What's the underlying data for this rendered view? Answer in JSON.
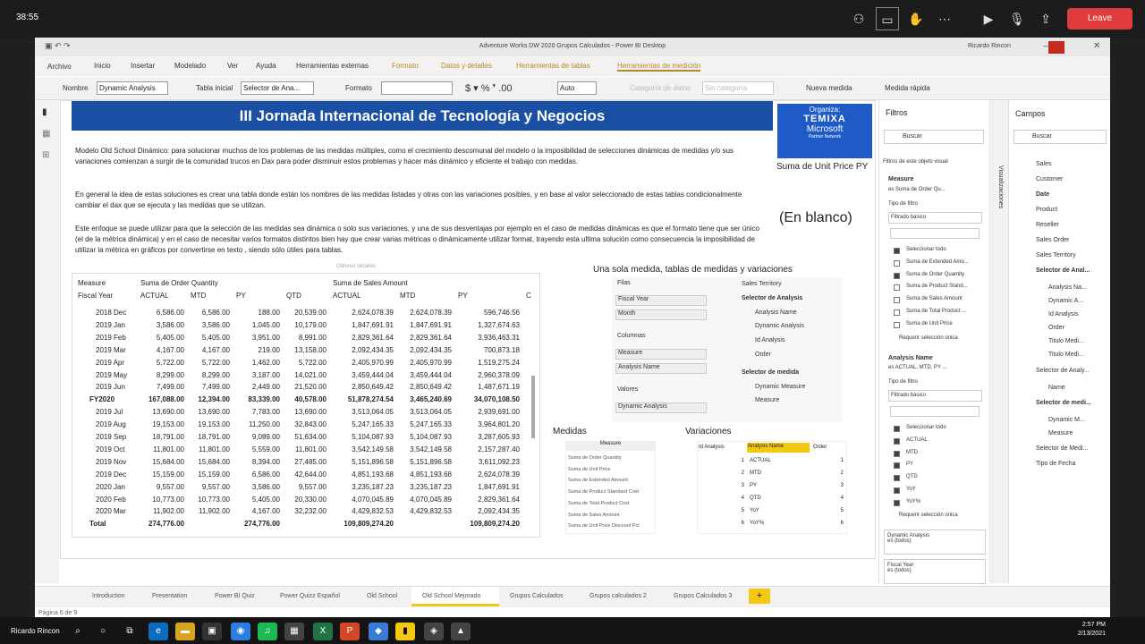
{
  "zoom": {
    "clock": "38:55",
    "leave": "Leave",
    "name": "Ricardo Rincon",
    "time": "2:57 PM",
    "date": "2/13/2021"
  },
  "window": {
    "title": "Adventure Works DW 2020 Grupos Calculados - Power BI Desktop",
    "user": "Ricardo Rincon"
  },
  "menu": [
    "Archivo",
    "Inicio",
    "Insertar",
    "Modelado",
    "Ver",
    "Ayuda",
    "Herramientas externas",
    "Formato",
    "Datos y detalles",
    "Herramientas de tablas",
    "Herramientas de medición"
  ],
  "toolbar": {
    "nombre_label": "Nombre",
    "nombre_value": "Dynamic Analysis",
    "tabla_label": "Tabla inicial",
    "tabla_value": "Selector de Ana...",
    "formato_label": "Formato",
    "auto_value": "Auto",
    "categoria": "Categoría de datos",
    "sin_categoria": "Sin categoría",
    "nueva": "Nueva medida",
    "rapida": "Medida rápida"
  },
  "banner": "III Jornada Internacional de Tecnología y Negocios",
  "logo": {
    "organiza": "Organiza:",
    "temixa": "TEMIXA",
    "microsoft": "Microsoft",
    "partner": "Partner Network"
  },
  "paragraphs": [
    "Modelo Old School Dinámico: para solucionar muchos de los problemas de las medidas múltiples, como el crecimiento descomunal del modelo o la imposibilidad de selecciones dinámicas de medidas y/o sus variaciones comienzan a surgir de la comunidad trucos en Dax para poder disminuir estos problemas y hacer más dinámico y eficiente el trabajo con medidas.",
    "En general la idea de estas soluciones es crear una tabla donde están los nombres de las medidas listadas y otras con las variaciones posibles, y en base al valor seleccionado de estas tablas condicionalmente cambiar el dax que se ejecuta y las medidas que se utilizan.",
    "Este enfoque se puede utilizar para que la selección de las medidas sea dinámica o solo sus variaciones, y una de sus desventajas por ejemplo en el caso de medidas dinámicas es que el formato tiene que ser único (el de la métrica dinámica) y en el caso de necesitar varios formatos distintos bien hay que crear varias métricas o dinámicamente utilizar format, trayendo esta ultima solución como consecuencia la imposibilidad de utilizar la métrica en gráficos por convertirse en texto , siendo sólo útiles para tablas."
  ],
  "card": {
    "title": "Suma de Unit Price PY",
    "value": "(En blanco)"
  },
  "matrix": {
    "h1": [
      "Measure",
      "Suma de Order Quantity",
      "Suma de Sales Amount"
    ],
    "h2": [
      "Fiscal Year",
      "ACTUAL",
      "MTD",
      "PY",
      "QTD",
      "ACTUAL",
      "MTD",
      "PY",
      "C"
    ],
    "rows": [
      [
        "2018 Dec",
        "6,586.00",
        "6,586.00",
        "188.00",
        "20,539.00",
        "2,624,078.39",
        "2,624,078.39",
        "596,746.56"
      ],
      [
        "2019 Jan",
        "3,586.00",
        "3,586.00",
        "1,045.00",
        "10,179.00",
        "1,847,691.91",
        "1,847,691.91",
        "1,327,674.63"
      ],
      [
        "2019 Feb",
        "5,405.00",
        "5,405.00",
        "3,951.00",
        "8,991.00",
        "2,829,361.64",
        "2,829,361.64",
        "3,936,463.31"
      ],
      [
        "2019 Mar",
        "4,167.00",
        "4,167.00",
        "219.00",
        "13,158.00",
        "2,092,434.35",
        "2,092,434.35",
        "700,873.18"
      ],
      [
        "2019 Apr",
        "5,722.00",
        "5,722.00",
        "1,462.00",
        "5,722.00",
        "2,405,970.99",
        "2,405,970.99",
        "1,519,275.24"
      ],
      [
        "2019 May",
        "8,299.00",
        "8,299.00",
        "3,187.00",
        "14,021.00",
        "3,459,444.04",
        "3,459,444.04",
        "2,960,378.09"
      ],
      [
        "2019 Jun",
        "7,499.00",
        "7,499.00",
        "2,449.00",
        "21,520.00",
        "2,850,649.42",
        "2,850,649.42",
        "1,487,671.19"
      ],
      [
        "FY2020",
        "167,088.00",
        "12,394.00",
        "83,339.00",
        "40,578.00",
        "51,878,274.54",
        "3,465,240.69",
        "34,070,108.50"
      ],
      [
        "2019 Jul",
        "13,690.00",
        "13,690.00",
        "7,783.00",
        "13,690.00",
        "3,513,064.05",
        "3,513,064.05",
        "2,939,691.00"
      ],
      [
        "2019 Aug",
        "19,153.00",
        "19,153.00",
        "11,250.00",
        "32,843.00",
        "5,247,165.33",
        "5,247,165.33",
        "3,964,801.20"
      ],
      [
        "2019 Sep",
        "18,791.00",
        "18,791.00",
        "9,089.00",
        "51,634.00",
        "5,104,087.93",
        "5,104,087.93",
        "3,287,605.93"
      ],
      [
        "2019 Oct",
        "11,801.00",
        "11,801.00",
        "5,559.00",
        "11,801.00",
        "3,542,149.58",
        "3,542,149.58",
        "2,157,287.40"
      ],
      [
        "2019 Nov",
        "15,684.00",
        "15,684.00",
        "8,394.00",
        "27,485.00",
        "5,151,896.58",
        "5,151,896.58",
        "3,611,092.23"
      ],
      [
        "2019 Dec",
        "15,159.00",
        "15,159.00",
        "6,586.00",
        "42,644.00",
        "4,851,193.68",
        "4,851,193.68",
        "2,624,078.39"
      ],
      [
        "2020 Jan",
        "9,557.00",
        "9,557.00",
        "3,586.00",
        "9,557.00",
        "3,235,187.23",
        "3,235,187.23",
        "1,847,691.91"
      ],
      [
        "2020 Feb",
        "10,773.00",
        "10,773.00",
        "5,405.00",
        "20,330.00",
        "4,070,045.89",
        "4,070,045.89",
        "2,829,361.64"
      ],
      [
        "2020 Mar",
        "11,902.00",
        "11,902.00",
        "4,167.00",
        "32,232.00",
        "4,429,832.53",
        "4,429,832.53",
        "2,092,434.35"
      ],
      [
        "Total",
        "274,776.00",
        "",
        "274,776.00",
        "",
        "109,809,274.20",
        "",
        "109,809,274.20"
      ]
    ]
  },
  "fieldwells": {
    "title": "Una sola medida, tablas de medidas y variaciones",
    "filas": "Filas",
    "filas_items": [
      "Fiscal Year",
      "Month"
    ],
    "columnas": "Columnas",
    "columnas_items": [
      "Measure",
      "Analysis Name"
    ],
    "valores": "Valores",
    "valores_items": [
      "Dynamic Analysis"
    ],
    "tree": [
      "Sales Territory",
      "Selector de Analysis",
      "Analysis Name",
      "Dynamic Analysis",
      "Id Analysis",
      "Order",
      "Selector de medida",
      "Dynamic Measure",
      "Measure"
    ]
  },
  "medidas": {
    "title": "Medidas",
    "header": "Measure",
    "items": [
      "Suma de Order Quantity",
      "Suma de Unit Price",
      "Suma de Extended Amount",
      "Suma de Product Standard Cost",
      "Suma de Total Product Cost",
      "Suma de Sales Amount",
      "Suma de Unit Price Discount Pct"
    ]
  },
  "variaciones": {
    "title": "Variaciones",
    "headers": [
      "Id Analysis",
      "Analysis Name",
      "Order"
    ],
    "rows": [
      [
        "1",
        "ACTUAL",
        "1"
      ],
      [
        "2",
        "MTD",
        "2"
      ],
      [
        "3",
        "PY",
        "3"
      ],
      [
        "4",
        "QTD",
        "4"
      ],
      [
        "5",
        "YoY",
        "5"
      ],
      [
        "6",
        "YoY%",
        "6"
      ]
    ]
  },
  "filters": {
    "title": "Filtros",
    "search": "Buscar",
    "section": "Filtros de este objeto visual",
    "f1_title": "Measure",
    "f1_sub": "es Suma de Order Qu...",
    "tipo": "Tipo de filtro",
    "basico": "Filtrado básico",
    "f1_items": [
      "Seleccionar todo",
      "Suma de Extended Amo...",
      "Suma de Order Quantity",
      "Suma de Product Stand...",
      "Suma de Sales Amount",
      "Suma de Total Product ...",
      "Suma de Unit Price"
    ],
    "req": "Requerir selección única",
    "f2_title": "Analysis Name",
    "f2_sub": "es ACTUAL, MTD, PY ...",
    "f2_items": [
      "Seleccionar todo",
      "ACTUAL",
      "MTD",
      "PY",
      "QTD",
      "YoY",
      "YoY%"
    ],
    "f3": [
      "Dynamic Analysis",
      "es (todos)"
    ],
    "f4": [
      "Fiscal Year",
      "es (todos)"
    ]
  },
  "viz_label": "Visualizaciones",
  "fields": {
    "title": "Campos",
    "search": "Buscar",
    "items": [
      "Sales",
      "Customer",
      "Date",
      "Product",
      "Reseller",
      "Sales Order",
      "Sales Territory",
      "Selector de Anal...",
      "Analysis Na...",
      "Dynamic A...",
      "Id Analysis",
      "Order",
      "Titulo Medi...",
      "Titulo Medi...",
      "Selector de Analy...",
      "Name",
      "Selector de medi...",
      "Dynamic M...",
      "Measure",
      "Selector de Medi...",
      "Tipo de Fecha"
    ]
  },
  "tabs": [
    "Introduction",
    "Presentation",
    "Power BI Quiz",
    "Power Quizz Español",
    "Old School",
    "Old School Mejorado",
    "Grupos Calculados",
    "Grupos calculados 2",
    "Grupos Calculados 3"
  ],
  "page_info": "Página 6 de 9",
  "obtener": "Obtener detalles"
}
